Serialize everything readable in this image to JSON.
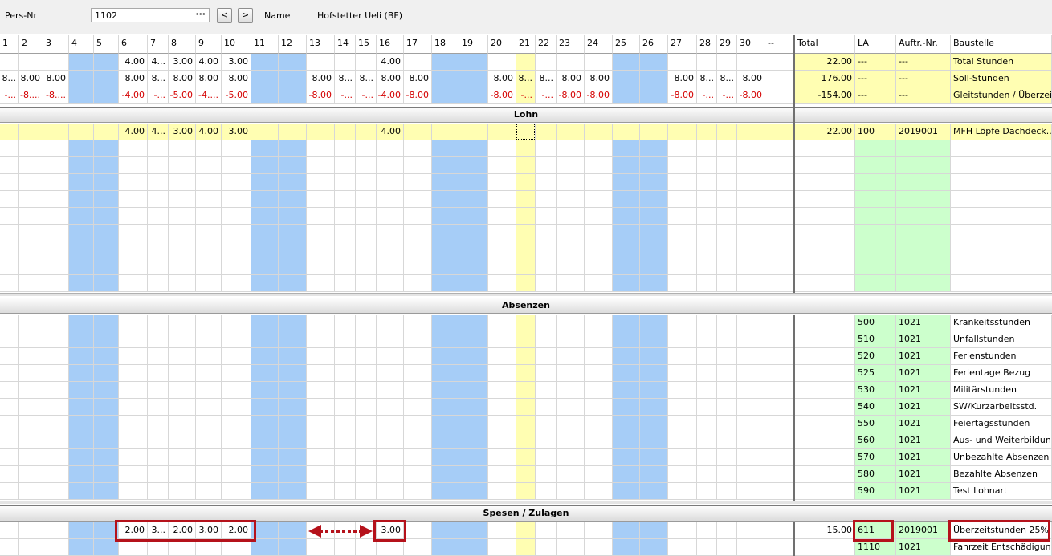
{
  "header": {
    "pers_nr_label": "Pers-Nr",
    "pers_nr_value": "1102",
    "pers_nr_button": "···",
    "prev_button": "<",
    "next_button": ">",
    "name_label": "Name",
    "name_value": "Hofstetter Ueli (BF)"
  },
  "columns": {
    "days": [
      "1",
      "2",
      "3",
      "4",
      "5",
      "6",
      "7",
      "8",
      "9",
      "10",
      "11",
      "12",
      "13",
      "14",
      "15",
      "16",
      "17",
      "18",
      "19",
      "20",
      "21",
      "22",
      "23",
      "24",
      "25",
      "26",
      "27",
      "28",
      "29",
      "30",
      "--"
    ],
    "total": "Total",
    "la": "LA",
    "auftr": "Auftr.-Nr.",
    "baustelle": "Baustelle"
  },
  "day_types": [
    "w",
    "w",
    "w",
    "b",
    "b",
    "w",
    "w",
    "w",
    "w",
    "w",
    "b",
    "b",
    "w",
    "w",
    "w",
    "w",
    "w",
    "b",
    "b",
    "w",
    "y",
    "w",
    "w",
    "w",
    "b",
    "b",
    "w",
    "w",
    "w",
    "w",
    "w"
  ],
  "summary_rows": [
    {
      "values": {
        "6": "4.00",
        "7": "4...",
        "8": "3.00",
        "9": "4.00",
        "10": "3.00",
        "16": "4.00"
      },
      "total": "22.00",
      "la": "---",
      "auftr": "---",
      "baustelle": "Total Stunden",
      "negative": false
    },
    {
      "values": {
        "1": "8...",
        "2": "8.00",
        "3": "8.00",
        "6": "8.00",
        "7": "8...",
        "8": "8.00",
        "9": "8.00",
        "10": "8.00",
        "13": "8.00",
        "14": "8...",
        "15": "8...",
        "16": "8.00",
        "17": "8.00",
        "20": "8.00",
        "21": "8...",
        "22": "8...",
        "23": "8.00",
        "24": "8.00",
        "27": "8.00",
        "28": "8...",
        "29": "8...",
        "30": "8.00"
      },
      "total": "176.00",
      "la": "---",
      "auftr": "---",
      "baustelle": "Soll-Stunden",
      "negative": false
    },
    {
      "values": {
        "1": "-...",
        "2": "-8....",
        "3": "-8....",
        "6": "-4.00",
        "7": "-...",
        "8": "-5.00",
        "9": "-4....",
        "10": "-5.00",
        "13": "-8.00",
        "14": "-...",
        "15": "-...",
        "16": "-4.00",
        "17": "-8.00",
        "20": "-8.00",
        "21": "-...",
        "22": "-...",
        "23": "-8.00",
        "24": "-8.00",
        "27": "-8.00",
        "28": "-...",
        "29": "-...",
        "30": "-8.00"
      },
      "total": "-154.00",
      "la": "---",
      "auftr": "---",
      "baustelle": "Gleitstunden / Überzeit",
      "negative": true
    }
  ],
  "sections": {
    "lohn": "Lohn",
    "absenzen": "Absenzen",
    "spesen": "Spesen / Zulagen"
  },
  "lohn_rows": [
    {
      "values": {
        "6": "4.00",
        "7": "4...",
        "8": "3.00",
        "9": "4.00",
        "10": "3.00",
        "16": "4.00"
      },
      "total": "22.00",
      "la": "100",
      "auftr": "2019001",
      "baustelle": "MFH Löpfe Dachdeck..."
    }
  ],
  "absenzen_rows": [
    {
      "la": "500",
      "auftr": "1021",
      "baustelle": "Krankeitsstunden"
    },
    {
      "la": "510",
      "auftr": "1021",
      "baustelle": "Unfallstunden"
    },
    {
      "la": "520",
      "auftr": "1021",
      "baustelle": "Ferienstunden"
    },
    {
      "la": "525",
      "auftr": "1021",
      "baustelle": "Ferientage Bezug"
    },
    {
      "la": "530",
      "auftr": "1021",
      "baustelle": "Militärstunden"
    },
    {
      "la": "540",
      "auftr": "1021",
      "baustelle": "SW/Kurzarbeitsstd."
    },
    {
      "la": "550",
      "auftr": "1021",
      "baustelle": "Feiertagsstunden"
    },
    {
      "la": "560",
      "auftr": "1021",
      "baustelle": "Aus- und Weiterbildung"
    },
    {
      "la": "570",
      "auftr": "1021",
      "baustelle": "Unbezahlte Absenzen"
    },
    {
      "la": "580",
      "auftr": "1021",
      "baustelle": "Bezahlte Absenzen"
    },
    {
      "la": "590",
      "auftr": "1021",
      "baustelle": "Test Lohnart"
    }
  ],
  "spesen_rows": [
    {
      "values": {
        "6": "2.00",
        "7": "3...",
        "8": "2.00",
        "9": "3.00",
        "10": "2.00",
        "16": "3.00"
      },
      "total": "15.00",
      "la": "611",
      "auftr": "2019001",
      "baustelle": "Überzeitstunden 25%"
    },
    {
      "values": {},
      "total": "",
      "la": "1110",
      "auftr": "1021",
      "baustelle": "Fahrzeit Entschädigung"
    }
  ],
  "colors": {
    "weekend": "#a6cdf7",
    "holiday": "#fffeb2",
    "summary_bg": "#fffeb2",
    "la_bg": "#ccffcc",
    "negative": "#d40000",
    "highlight": "#b5121b"
  }
}
